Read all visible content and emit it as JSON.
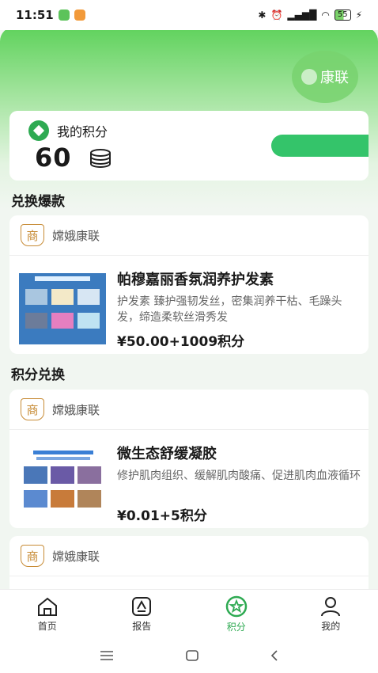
{
  "status": {
    "time": "11:51",
    "battery": "55"
  },
  "brand": {
    "logo_text": "康联"
  },
  "points": {
    "label": "我的积分",
    "value": "60"
  },
  "sections": {
    "hot": "兑换爆款",
    "exchange": "积分兑换"
  },
  "products": [
    {
      "shop": "嫦娥康联",
      "title": "帕穆嘉丽香氛润养护发素",
      "desc": "护发素 臻护强韧发丝，密集润养干枯、毛躁头发，缔造柔软丝滑秀发",
      "price": "¥50.00+1009积分"
    },
    {
      "shop": "嫦娥康联",
      "title": "微生态舒缓凝胶",
      "desc": "修护肌肉组织、缓解肌肉酸痛、促进肌肉血液循环",
      "price": "¥0.01+5积分"
    },
    {
      "shop": "嫦娥康联"
    }
  ],
  "tabs": [
    {
      "label": "首页",
      "icon": "home-icon"
    },
    {
      "label": "报告",
      "icon": "report-icon"
    },
    {
      "label": "积分",
      "icon": "points-star-icon"
    },
    {
      "label": "我的",
      "icon": "user-icon"
    }
  ],
  "colors": {
    "accent": "#2eaa52",
    "header": "#5fd25c",
    "shop": "#c78b35"
  }
}
